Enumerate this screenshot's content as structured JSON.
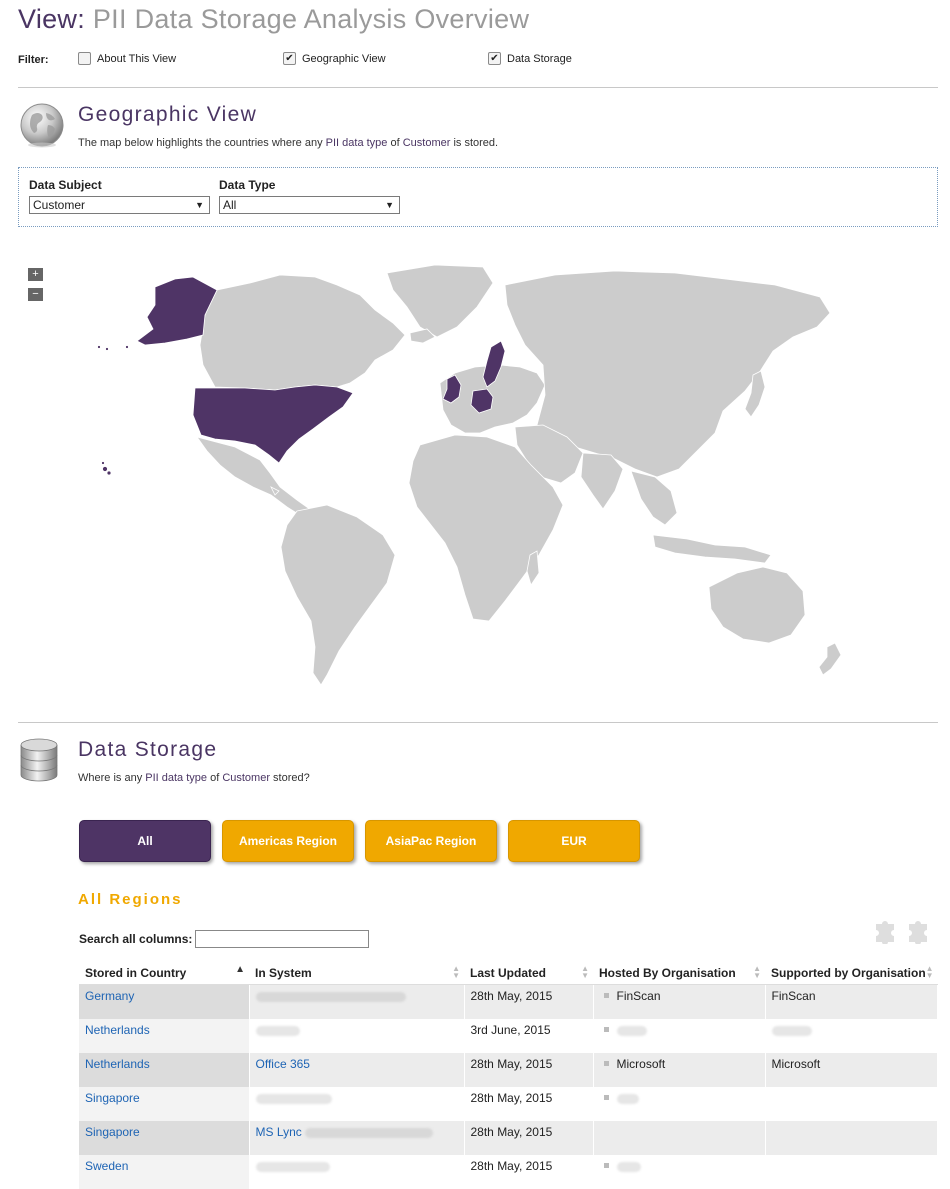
{
  "page": {
    "title_prefix": "View:",
    "title_name": "PII Data Storage Analysis Overview"
  },
  "filter": {
    "label": "Filter:",
    "options": [
      {
        "label": "About This View",
        "checked": false
      },
      {
        "label": "Geographic View",
        "checked": true
      },
      {
        "label": "Data Storage",
        "checked": true
      }
    ]
  },
  "geo": {
    "title": "Geographic View",
    "desc_part1": "The map below highlights the countries where any ",
    "desc_hl1": "PII data type",
    "desc_part2": " of ",
    "desc_hl2": "Customer",
    "desc_part3": " is stored.",
    "subject_label": "Data Subject",
    "subject_value": "Customer",
    "type_label": "Data Type",
    "type_value": "All",
    "zoom_in": "+",
    "zoom_out": "−",
    "highlight_color": "#4f3466",
    "land_color": "#cccccc"
  },
  "storage": {
    "title": "Data Storage",
    "desc_part1": "Where is any ",
    "desc_hl1": "PII data type",
    "desc_part2": " of ",
    "desc_hl2": "Customer",
    "desc_part3": " stored?",
    "tabs": [
      {
        "label": "All",
        "active": true
      },
      {
        "label": "Americas Region",
        "active": false
      },
      {
        "label": "AsiaPac Region",
        "active": false
      },
      {
        "label": "EUR",
        "active": false
      }
    ],
    "regions_title": "All Regions",
    "search_label": "Search all columns:",
    "search_value": "",
    "columns": [
      "Stored in Country",
      "In System",
      "Last Updated",
      "Hosted By Organisation",
      "Supported by Organisation"
    ],
    "rows": [
      {
        "country": "Germany",
        "system": "",
        "updated": "28th May, 2015",
        "hosted": "FinScan",
        "supported": "FinScan"
      },
      {
        "country": "Netherlands",
        "system": "",
        "updated": "3rd June, 2015",
        "hosted": "",
        "supported": ""
      },
      {
        "country": "Netherlands",
        "system": "Office 365",
        "updated": "28th May, 2015",
        "hosted": "Microsoft",
        "supported": "Microsoft"
      },
      {
        "country": "Singapore",
        "system": "",
        "updated": "28th May, 2015",
        "hosted": "",
        "supported": ""
      },
      {
        "country": "Singapore",
        "system": "MS Lync",
        "updated": "28th May, 2015",
        "hosted": "",
        "supported": ""
      },
      {
        "country": "Sweden",
        "system": "",
        "updated": "28th May, 2015",
        "hosted": "",
        "supported": ""
      }
    ],
    "accent_purple": "#4e3465",
    "accent_orange": "#f0a800"
  }
}
